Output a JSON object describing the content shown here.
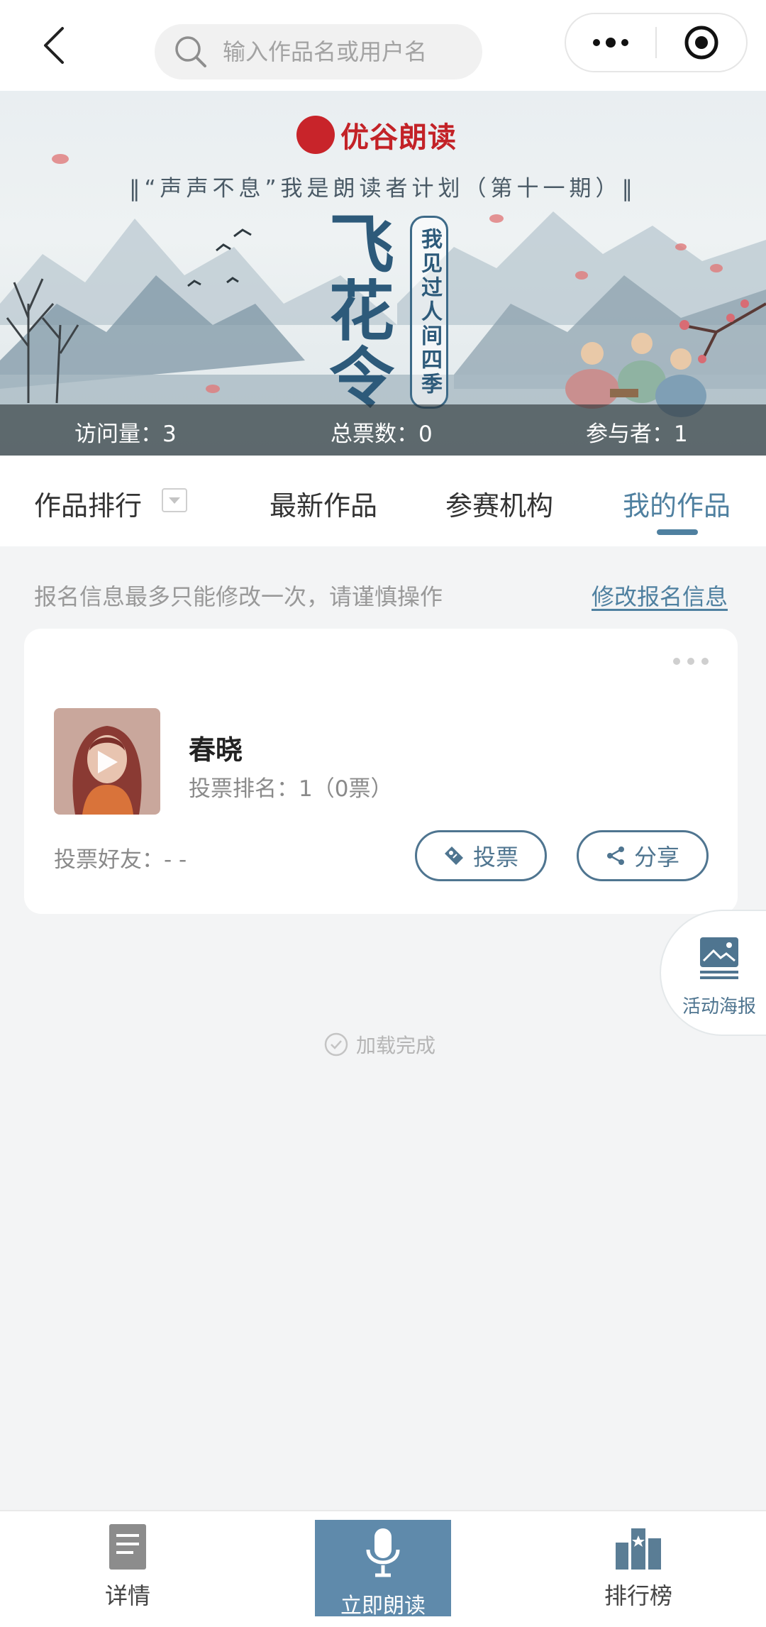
{
  "header": {
    "search_placeholder": "输入作品名或用户名"
  },
  "banner": {
    "brand": "优谷朗读",
    "subtitle": "‖“声声不息”我是朗读者计划（第十一期）‖",
    "title_chars": [
      "飞",
      "花",
      "令"
    ],
    "tag": "我见过人间四季",
    "stats": {
      "visits": "访问量：3",
      "votes": "总票数：0",
      "participants": "参与者：1"
    }
  },
  "tabs": [
    {
      "label": "作品排行",
      "active": false
    },
    {
      "label": "最新作品",
      "active": false
    },
    {
      "label": "参赛机构",
      "active": false
    },
    {
      "label": "我的作品",
      "active": true
    }
  ],
  "notice": {
    "text": "报名信息最多只能修改一次，请谨慎操作",
    "edit_link": "修改报名信息"
  },
  "work": {
    "title": "春晓",
    "rank": "投票排名：1（0票）",
    "friends": "投票好友：- -",
    "vote_button": "投票",
    "share_button": "分享"
  },
  "float_button": {
    "label": "活动海报"
  },
  "load_status": "加载完成",
  "bottom_nav": {
    "details": "详情",
    "read_now": "立即朗读",
    "ranking": "排行榜"
  },
  "colors": {
    "accent": "#4f80a0",
    "brand_red": "#c32227",
    "nav_center": "#5f8aab",
    "page_bg": "#f3f4f5"
  }
}
